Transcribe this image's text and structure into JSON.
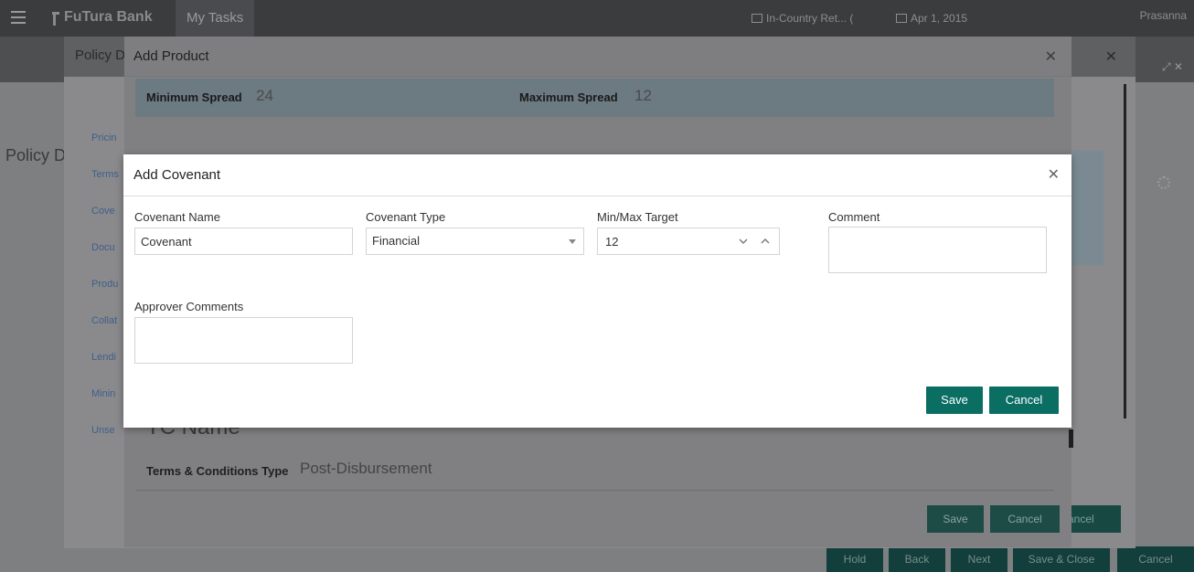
{
  "topbar": {
    "brand": "FuTura Bank",
    "tab": "My Tasks",
    "branch": "In-Country Ret... (",
    "date": "Apr 1, 2015",
    "user": "Prasanna"
  },
  "background": {
    "page_title": "Policy De",
    "footer_buttons": [
      "Hold",
      "Back",
      "Next",
      "Save & Close",
      "Cancel"
    ]
  },
  "policy_dialog": {
    "title": "Policy D",
    "nav": [
      "Pricin",
      "Terms",
      "Cove",
      "Docu",
      "Produ",
      "Collat",
      "Lendi",
      "Minin",
      "Unse"
    ],
    "cancel_label": "ancel"
  },
  "product_dialog": {
    "title": "Add Product",
    "min_spread_label": "Minimum Spread",
    "min_spread_value": "24",
    "max_spread_label": "Maximum Spread",
    "max_spread_value": "12",
    "tc_name_label": "TC Name",
    "tc_type_label": "Terms & Conditions Type",
    "tc_type_value": "Post-Disbursement",
    "save_label": "Save",
    "cancel_label": "Cancel"
  },
  "covenant_dialog": {
    "title": "Add Covenant",
    "name_label": "Covenant Name",
    "name_value": "Covenant",
    "type_label": "Covenant Type",
    "type_value": "Financial",
    "target_label": "Min/Max Target",
    "target_value": "12",
    "comment_label": "Comment",
    "approver_label": "Approver Comments",
    "save_label": "Save",
    "cancel_label": "Cancel"
  }
}
